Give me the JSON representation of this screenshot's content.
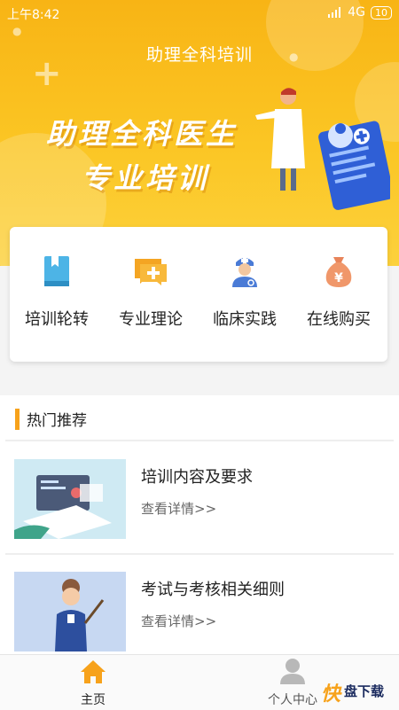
{
  "status_bar": {
    "time": "上午8:42",
    "network": "4G",
    "battery": "10"
  },
  "header": {
    "title": "助理全科培训"
  },
  "banner": {
    "line1": "助理全科医生",
    "line2": "专业培训"
  },
  "categories": [
    {
      "label": "培训轮转",
      "icon": "book-icon"
    },
    {
      "label": "专业理论",
      "icon": "chat-plus-icon"
    },
    {
      "label": "临床实践",
      "icon": "doctor-icon"
    },
    {
      "label": "在线购买",
      "icon": "money-bag-icon"
    }
  ],
  "section": {
    "title": "热门推荐"
  },
  "items": [
    {
      "title": "培训内容及要求",
      "more": "查看详情>>"
    },
    {
      "title": "考试与考核相关细则",
      "more": "查看详情>>"
    }
  ],
  "tabbar": [
    {
      "label": "主页",
      "icon": "home-icon",
      "active": true
    },
    {
      "label": "个人中心",
      "icon": "user-icon",
      "active": false
    }
  ],
  "watermark": {
    "brand": "快",
    "text": "盘下载"
  },
  "colors": {
    "accent": "#f7a21b",
    "active_tab": "#f7a21b",
    "hero_top": "#f8b415",
    "hero_bottom": "#fcd13c"
  }
}
